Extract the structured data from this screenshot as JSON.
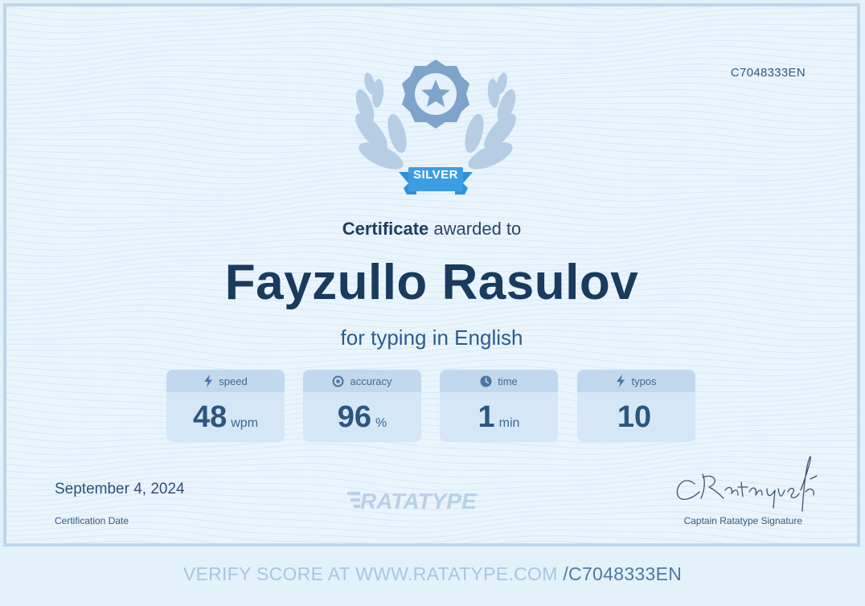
{
  "certificate": {
    "id": "C7048333EN",
    "level": "SILVER",
    "headline_bold": "Certificate",
    "headline_rest": "awarded to",
    "recipient": "Fayzullo Rasulov",
    "subtitle": "for typing in English"
  },
  "stats": [
    {
      "label": "speed",
      "value": "48",
      "unit": "wpm",
      "icon": "lightning-icon"
    },
    {
      "label": "accuracy",
      "value": "96",
      "unit": "%",
      "icon": "target-icon"
    },
    {
      "label": "time",
      "value": "1",
      "unit": "min",
      "icon": "clock-icon"
    },
    {
      "label": "typos",
      "value": "10",
      "unit": "",
      "icon": "lightning-icon"
    }
  ],
  "footer": {
    "date": "September 4, 2024",
    "date_label": "Certification Date",
    "brand": "RATATYPE",
    "signature_text": "CRatatype fé",
    "signature_label": "Captain Ratatype Signature"
  },
  "verify": {
    "prefix": "VERIFY SCORE AT WWW.RATATYPE.COM",
    "code": "/C7048333EN"
  },
  "colors": {
    "background": "#e9f4fc",
    "accent_blue": "#3d9de3",
    "ink": "#1a3a5e"
  }
}
